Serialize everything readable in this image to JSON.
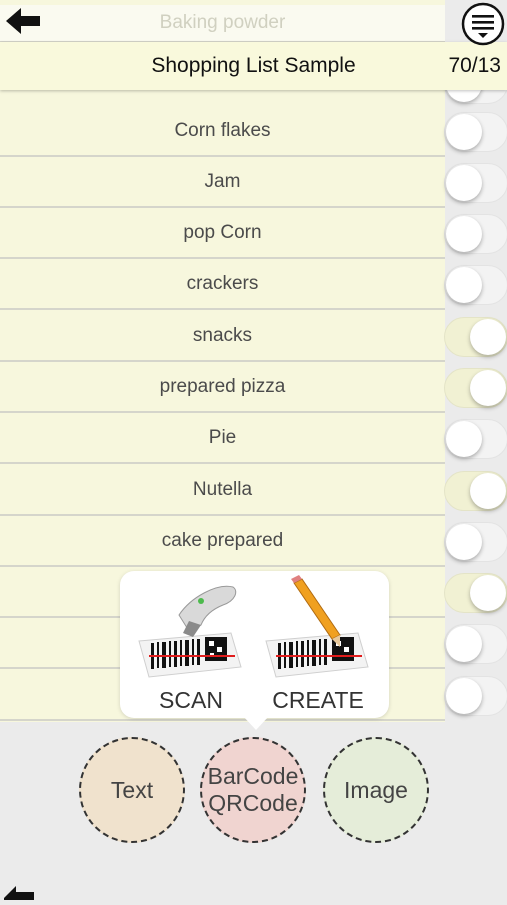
{
  "header": {
    "title": "Shopping List Sample",
    "counter": "70/13",
    "back_icon": "left-arrow-icon",
    "menu_icon": "hamburger-menu-icon"
  },
  "list": {
    "partial_top_item": "Baking powder",
    "items": [
      {
        "label": "Corn flakes",
        "checked": false
      },
      {
        "label": "Jam",
        "checked": false
      },
      {
        "label": "pop Corn",
        "checked": false
      },
      {
        "label": "crackers",
        "checked": false
      },
      {
        "label": "snacks",
        "checked": true
      },
      {
        "label": "prepared pizza",
        "checked": true
      },
      {
        "label": "Pie",
        "checked": false
      },
      {
        "label": "Nutella",
        "checked": true
      },
      {
        "label": "cake prepared",
        "checked": false
      },
      {
        "label": "",
        "checked": true
      },
      {
        "label": "",
        "checked": false
      },
      {
        "label": "",
        "checked": false
      }
    ]
  },
  "popup": {
    "scan_label": "SCAN",
    "create_label": "CREATE",
    "scan_icon": "barcode-scanner-icon",
    "create_icon": "barcode-pencil-icon"
  },
  "add_buttons": {
    "text": "Text",
    "barcode_line1": "BarCode",
    "barcode_line2": "QRCode",
    "image": "Image"
  },
  "colors": {
    "row_bg": "#f7f7dd",
    "text_circle": "#f0e2cd",
    "barcode_circle": "#f0d4d0",
    "image_circle": "#e5edd9"
  }
}
